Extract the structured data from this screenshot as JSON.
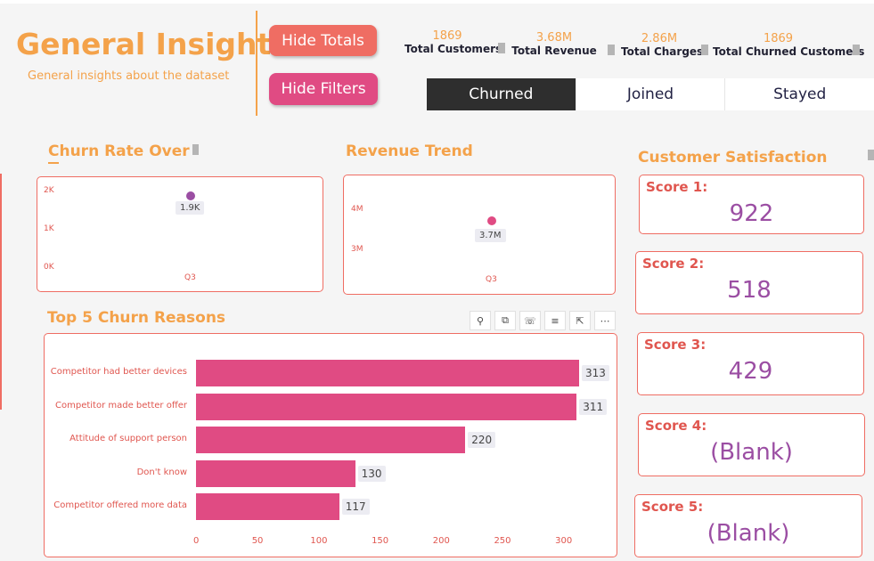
{
  "header": {
    "title": "General Insights",
    "subtitle": "General insights about the dataset",
    "hide_totals": "Hide Totals",
    "hide_filters": "Hide Filters"
  },
  "kpis": [
    {
      "value": "1869",
      "label": "Total Customers"
    },
    {
      "value": "3.68M",
      "label": "Total Revenue"
    },
    {
      "value": "2.86M",
      "label": "Total Charges"
    },
    {
      "value": "1869",
      "label": "Total Churned Customers"
    }
  ],
  "tabs": [
    {
      "label": "Churned",
      "active": true
    },
    {
      "label": "Joined",
      "active": false
    },
    {
      "label": "Stayed",
      "active": false
    }
  ],
  "churn_rate": {
    "title": "Churn Rate Over",
    "y_ticks": [
      "2K",
      "1K",
      "0K"
    ],
    "x_ticks": [
      "Q3"
    ],
    "point_label": "1.9K"
  },
  "revenue_trend": {
    "title": "Revenue Trend",
    "y_ticks": [
      "4M",
      "3M"
    ],
    "x_ticks": [
      "Q3"
    ],
    "point_label": "3.7M"
  },
  "churn_reasons": {
    "title": "Top 5 Churn Reasons",
    "toolbar": [
      "pin-icon",
      "copy-icon",
      "bell-icon",
      "filter-icon",
      "expand-icon",
      "more-icon"
    ],
    "x_ticks": [
      "0",
      "50",
      "100",
      "150",
      "200",
      "250",
      "300"
    ]
  },
  "satisfaction": {
    "title": "Customer Satisfaction Score Distribution",
    "scores": [
      {
        "label": "Score 1:",
        "value": "922"
      },
      {
        "label": "Score 2:",
        "value": "518"
      },
      {
        "label": "Score 3:",
        "value": "429"
      },
      {
        "label": "Score 4:",
        "value": "(Blank)"
      },
      {
        "label": "Score 5:",
        "value": "(Blank)"
      }
    ]
  },
  "colors": {
    "accent_orange": "#f4a24a",
    "coral": "#ef6d63",
    "pink": "#e04b83",
    "purple": "#9b4ea3",
    "tab_dark": "#2e2e2e"
  },
  "chart_data": [
    {
      "type": "scatter",
      "title": "Churn Rate Over",
      "categories": [
        "Q3"
      ],
      "values": [
        1869
      ],
      "ylim": [
        0,
        2000
      ]
    },
    {
      "type": "scatter",
      "title": "Revenue Trend",
      "categories": [
        "Q3"
      ],
      "values": [
        3680000
      ],
      "ylim": [
        2600000,
        4300000
      ]
    },
    {
      "type": "bar",
      "title": "Top 5 Churn Reasons",
      "orientation": "horizontal",
      "categories": [
        "Competitor had better devices",
        "Competitor made better offer",
        "Attitude of support person",
        "Don't know",
        "Competitor offered more data"
      ],
      "values": [
        313,
        311,
        220,
        130,
        117
      ],
      "xlim": [
        0,
        313
      ]
    }
  ]
}
